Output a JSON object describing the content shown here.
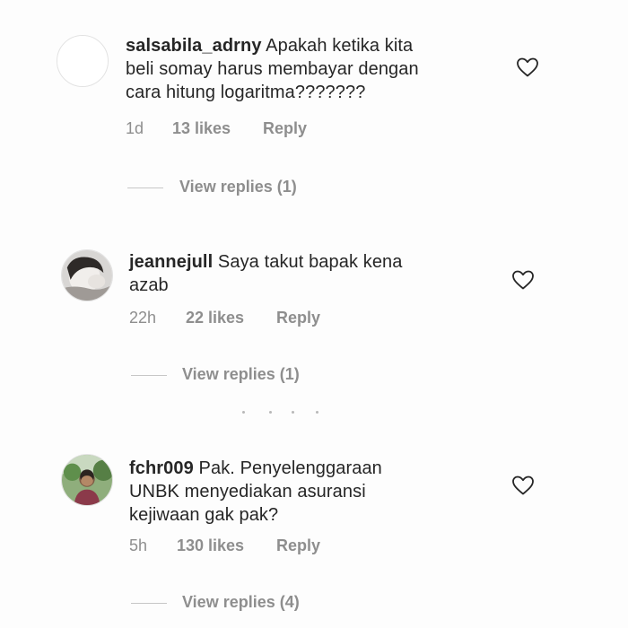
{
  "comments": [
    {
      "username": "salsabila_adrny",
      "lines": [
        "Apakah ketika kita",
        "beli somay harus membayar dengan",
        "cara hitung logaritma???????"
      ],
      "time": "1d",
      "likes": "13 likes",
      "reply": "Reply",
      "view_replies": "View replies (1)",
      "avatar_icon": "blank-avatar-icon"
    },
    {
      "username": "jeannejull",
      "lines": [
        "Saya takut bapak kena",
        "azab"
      ],
      "time": "22h",
      "likes": "22 likes",
      "reply": "Reply",
      "view_replies": "View replies (1)",
      "avatar_icon": "photo-avatar-icon"
    },
    {
      "username": "fchr009",
      "lines": [
        "Pak. Penyelenggaraan",
        "UNBK menyediakan asuransi",
        "kejiwaan gak pak?"
      ],
      "time": "5h",
      "likes": "130 likes",
      "reply": "Reply",
      "view_replies": "View replies (4)",
      "avatar_icon": "photo-avatar-icon"
    }
  ],
  "colors": {
    "text": "#262626",
    "muted": "#8e8e8e",
    "divider": "#c7c7c7"
  }
}
